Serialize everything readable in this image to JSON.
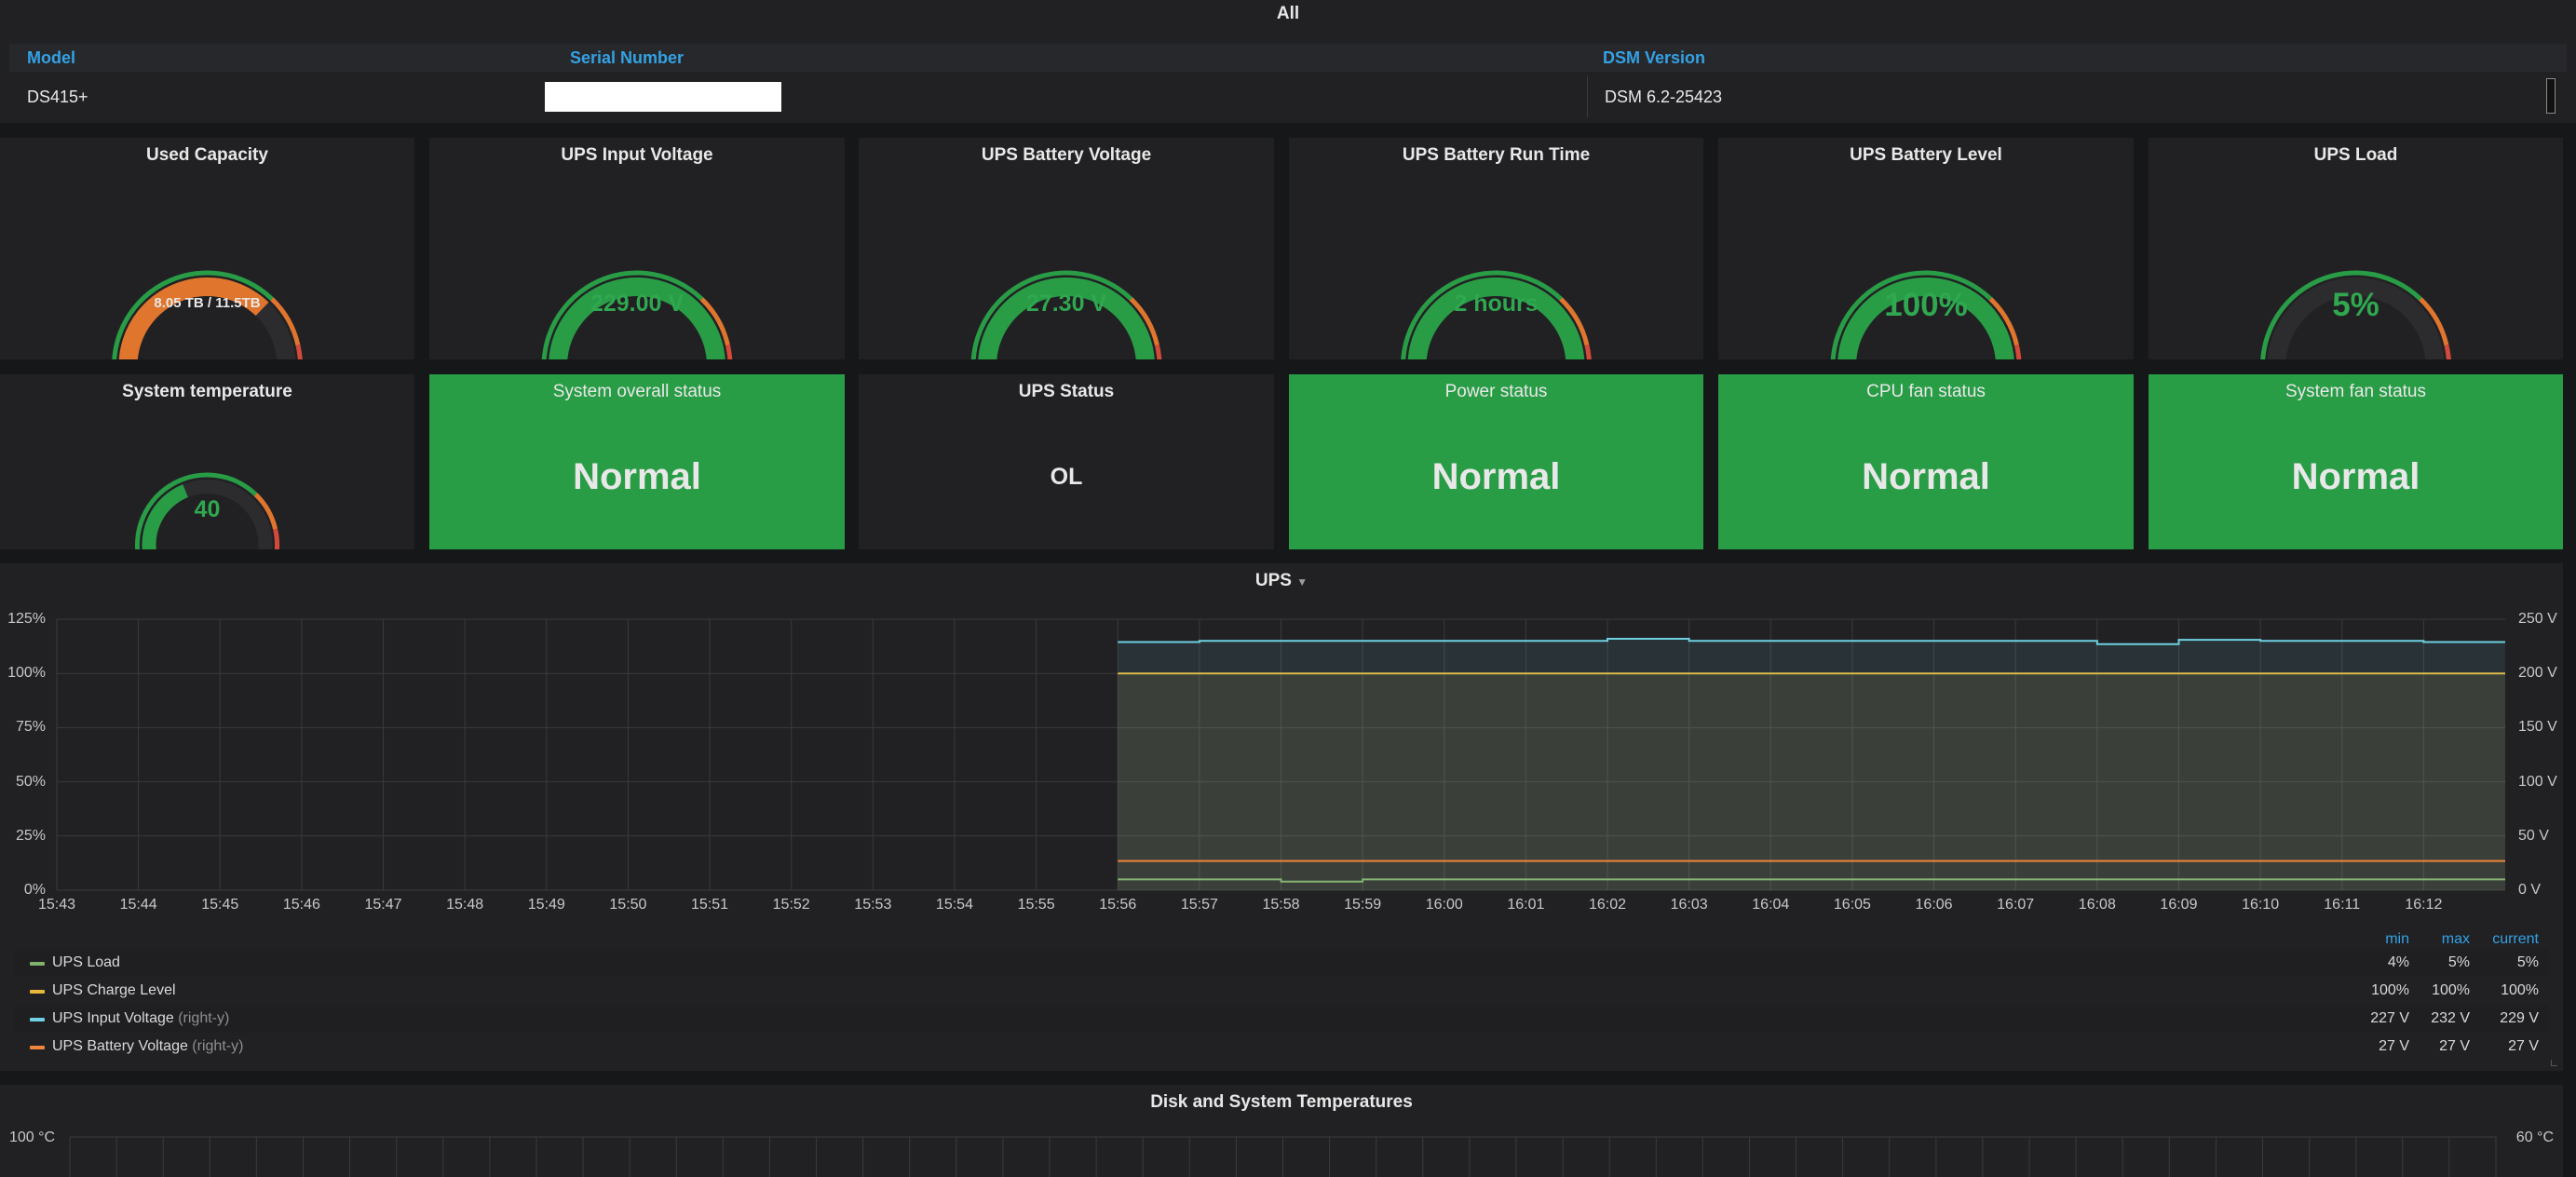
{
  "info_table": {
    "title": "All",
    "headers": {
      "model": "Model",
      "serial": "Serial Number",
      "dsm": "DSM Version"
    },
    "row": {
      "model": "DS415+",
      "serial": "",
      "dsm": "DSM 6.2-25423"
    }
  },
  "gauges": [
    {
      "title": "Used Capacity",
      "value_text": "8.05 TB / 11.5TB",
      "fraction": 0.7,
      "fill_color": "#e0752d"
    },
    {
      "title": "UPS Input Voltage",
      "value_text": "229.00 V",
      "fraction": 1.0,
      "fill_color": "#299c46"
    },
    {
      "title": "UPS Battery Voltage",
      "value_text": "27.30 V",
      "fraction": 1.0,
      "fill_color": "#299c46"
    },
    {
      "title": "UPS Battery Run Time",
      "value_text": "2 hours",
      "fraction": 1.0,
      "fill_color": "#299c46"
    },
    {
      "title": "UPS Battery Level",
      "value_text": "100%",
      "fraction": 1.0,
      "fill_color": "#299c46"
    },
    {
      "title": "UPS Load",
      "value_text": "5%",
      "fraction": 0.05,
      "fill_color": "#299c46"
    },
    {
      "title": "System temperature",
      "value_text": "40",
      "fraction": 0.4,
      "fill_color": "#299c46"
    }
  ],
  "status_panels": [
    {
      "title": "System overall status",
      "value": "Normal",
      "bg": "#299c46"
    },
    {
      "title": "UPS Status",
      "value": "OL",
      "bg": "#212124"
    },
    {
      "title": "Power status",
      "value": "Normal",
      "bg": "#299c46"
    },
    {
      "title": "CPU fan status",
      "value": "Normal",
      "bg": "#299c46"
    },
    {
      "title": "System fan status",
      "value": "Normal",
      "bg": "#299c46"
    }
  ],
  "chart_panel_title": "UPS",
  "chart_data": {
    "type": "line",
    "title": "UPS",
    "x": [
      "15:56",
      "15:57",
      "15:58",
      "15:59",
      "16:00",
      "16:01",
      "16:02",
      "16:03",
      "16:04",
      "16:05",
      "16:06",
      "16:07",
      "16:08",
      "16:09",
      "16:10",
      "16:11",
      "16:12"
    ],
    "x_ticks": [
      "15:43",
      "15:44",
      "15:45",
      "15:46",
      "15:47",
      "15:48",
      "15:49",
      "15:50",
      "15:51",
      "15:52",
      "15:53",
      "15:54",
      "15:55",
      "15:56",
      "15:57",
      "15:58",
      "15:59",
      "16:00",
      "16:01",
      "16:02",
      "16:03",
      "16:04",
      "16:05",
      "16:06",
      "16:07",
      "16:08",
      "16:09",
      "16:10",
      "16:11",
      "16:12"
    ],
    "x_range": [
      "15:43",
      "16:13"
    ],
    "y_left": {
      "ticks": [
        "0%",
        "25%",
        "50%",
        "75%",
        "100%",
        "125%"
      ],
      "range": [
        0,
        125
      ]
    },
    "y_right": {
      "ticks": [
        "0 V",
        "50 V",
        "100 V",
        "150 V",
        "200 V",
        "250 V"
      ],
      "range": [
        0,
        250
      ]
    },
    "grid": true,
    "series": [
      {
        "name": "UPS Load",
        "axis": "left",
        "color": "#7eb26d",
        "values": [
          5,
          5,
          4,
          5,
          5,
          5,
          5,
          5,
          5,
          5,
          5,
          5,
          5,
          5,
          5,
          5,
          5
        ]
      },
      {
        "name": "UPS Charge Level",
        "axis": "left",
        "color": "#eab839",
        "area": true,
        "values": [
          100,
          100,
          100,
          100,
          100,
          100,
          100,
          100,
          100,
          100,
          100,
          100,
          100,
          100,
          100,
          100,
          100
        ]
      },
      {
        "name": "UPS Input Voltage",
        "axis": "right",
        "color": "#6ed0e0",
        "area": true,
        "values": [
          229,
          230,
          230,
          230,
          230,
          230,
          232,
          230,
          230,
          230,
          230,
          230,
          227,
          231,
          230,
          230,
          229
        ]
      },
      {
        "name": "UPS Battery Voltage",
        "axis": "right",
        "color": "#ef843c",
        "values": [
          27,
          27,
          27,
          27,
          27,
          27,
          27,
          27,
          27,
          27,
          27,
          27,
          27,
          27,
          27,
          27,
          27
        ]
      }
    ]
  },
  "legend": {
    "col_headers": [
      "min",
      "max",
      "current"
    ],
    "right_y_tag": "(right-y)",
    "rows": [
      {
        "name": "UPS Load",
        "color": "#7eb26d",
        "right_y": false,
        "min": "4%",
        "max": "5%",
        "current": "5%"
      },
      {
        "name": "UPS Charge Level",
        "color": "#eab839",
        "right_y": false,
        "min": "100%",
        "max": "100%",
        "current": "100%"
      },
      {
        "name": "UPS Input Voltage",
        "color": "#6ed0e0",
        "right_y": true,
        "min": "227 V",
        "max": "232 V",
        "current": "229 V"
      },
      {
        "name": "UPS Battery Voltage",
        "color": "#ef843c",
        "right_y": true,
        "min": "27 V",
        "max": "27 V",
        "current": "27 V"
      }
    ]
  },
  "temp_panel": {
    "title": "Disk and System Temperatures",
    "y_left_top": "100 °C",
    "y_right_top": "60 °C"
  }
}
